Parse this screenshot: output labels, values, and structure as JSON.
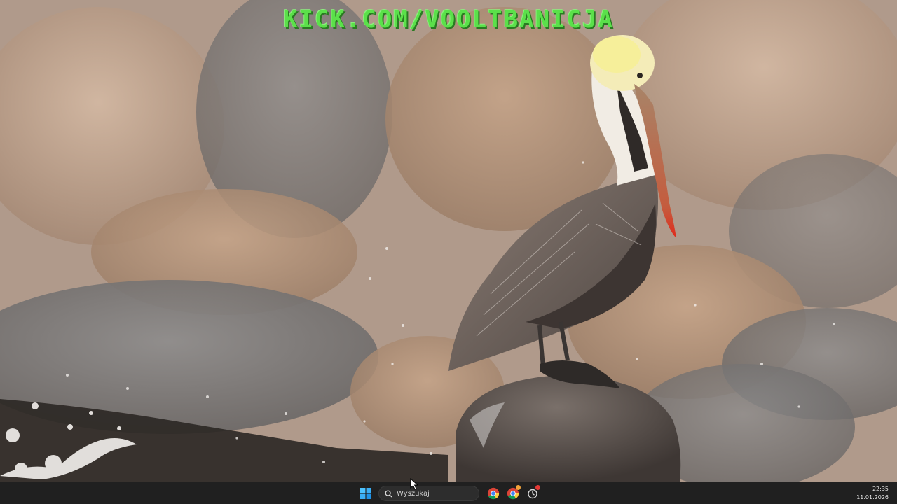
{
  "wallpaper": {
    "overlay_text": "KICK.COM/VOOLTBANICJA",
    "overlay_color": "#5be04a",
    "subject": "pelican-on-rock"
  },
  "taskbar": {
    "start_icon": "windows-start-icon",
    "search_placeholder": "Wyszukaj",
    "pinned": [
      {
        "name": "chrome-icon"
      },
      {
        "name": "chrome-notification-icon",
        "badge_color": "#f2a33a"
      },
      {
        "name": "timer-app-icon",
        "badge_color": "#e53935"
      }
    ],
    "clock": {
      "time": "22:35",
      "date": "11.01.2026"
    }
  }
}
